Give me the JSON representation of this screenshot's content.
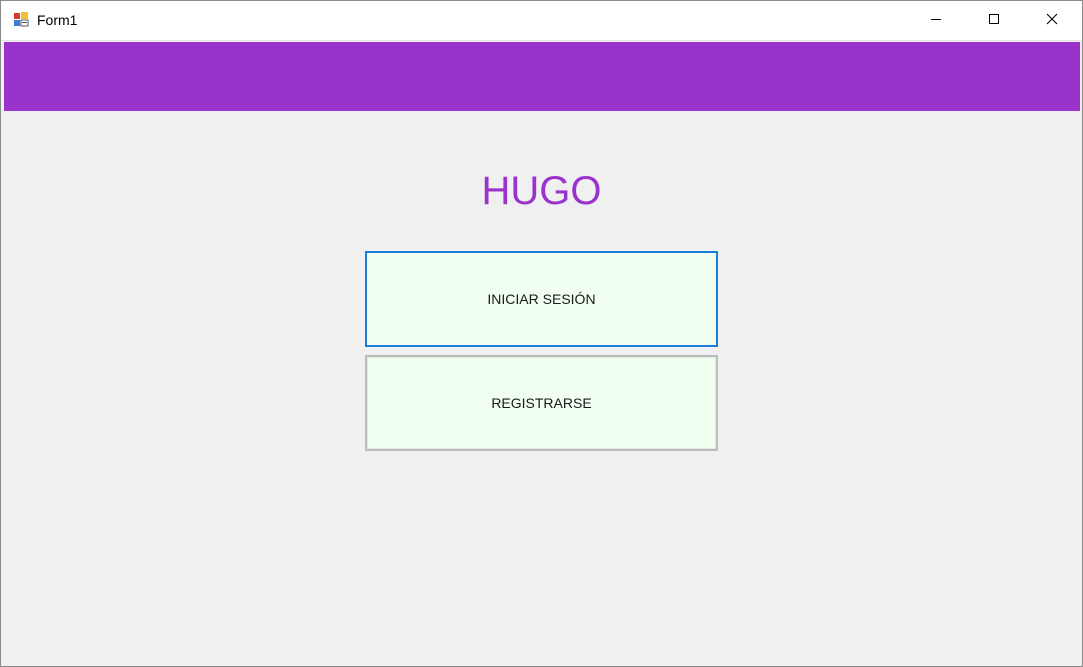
{
  "window": {
    "title": "Form1",
    "app_icon": "winforms-app-icon",
    "controls": {
      "minimize_icon": "minimize-icon",
      "maximize_icon": "maximize-icon",
      "close_icon": "close-icon"
    }
  },
  "header": {
    "color": "#9933cc"
  },
  "main": {
    "title": "HUGO",
    "title_color": "#9933cc",
    "login_label": "INICIAR SESIÓN",
    "register_label": "REGISTRARSE",
    "button_background": "#f0fff0",
    "focused_border_color": "#1a7fd9"
  }
}
